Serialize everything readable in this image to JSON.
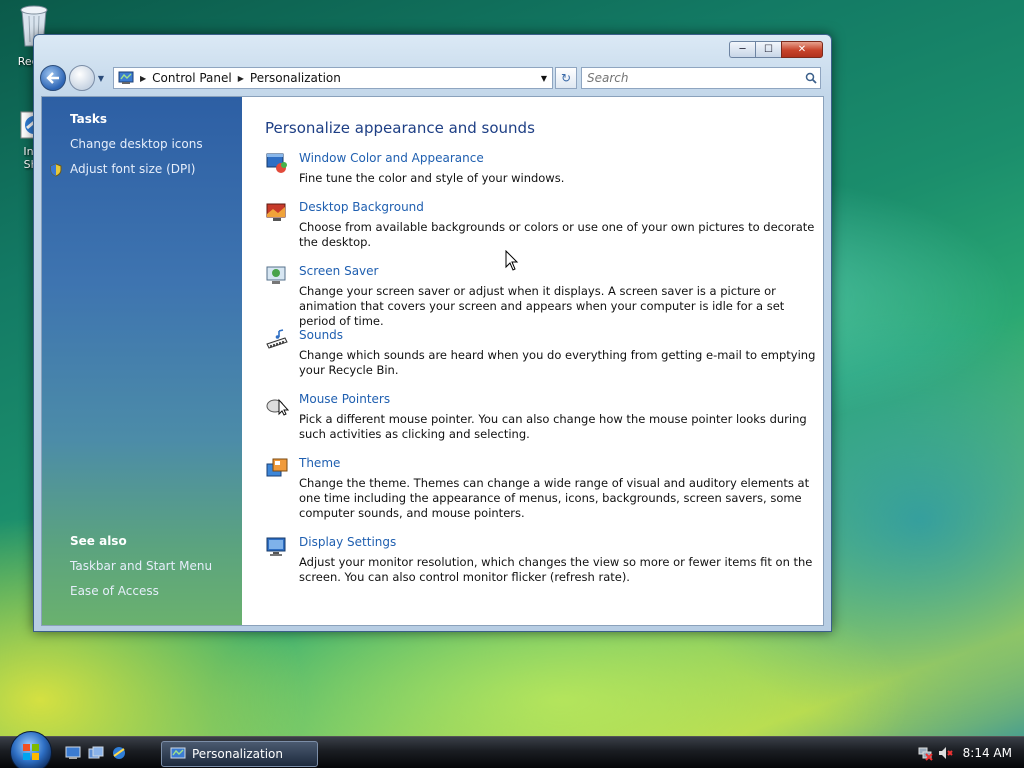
{
  "desktop": {
    "recycle_bin_label": "Recyc",
    "ie_label_line1": "Inte",
    "ie_label_line2": "Sho"
  },
  "window": {
    "caption_buttons": {
      "minimize": "─",
      "maximize": "☐",
      "close": "✕"
    },
    "address": {
      "crumbs": [
        "Control Panel",
        "Personalization"
      ],
      "separator": "▶",
      "dropdown": "▼"
    },
    "refresh_glyph": "↻",
    "search": {
      "placeholder": "Search"
    },
    "sidebar": {
      "tasks_heading": "Tasks",
      "tasks": [
        "Change desktop icons",
        "Adjust font size (DPI)"
      ],
      "see_also_heading": "See also",
      "see_also": [
        "Taskbar and Start Menu",
        "Ease of Access"
      ]
    },
    "main": {
      "title": "Personalize appearance and sounds",
      "items": [
        {
          "icon": "window-color-icon",
          "label": "Window Color and Appearance",
          "description": "Fine tune the color and style of your windows."
        },
        {
          "icon": "desktop-background-icon",
          "label": "Desktop Background",
          "description": "Choose from available backgrounds or colors or use one of your own pictures to decorate the desktop."
        },
        {
          "icon": "screen-saver-icon",
          "label": "Screen Saver",
          "description": "Change your screen saver or adjust when it displays. A screen saver is a picture or animation that covers your screen and appears when your computer is idle for a set period of time."
        },
        {
          "icon": "sounds-icon",
          "label": "Sounds",
          "description": "Change which sounds are heard when you do everything from getting e-mail to emptying your Recycle Bin."
        },
        {
          "icon": "mouse-pointers-icon",
          "label": "Mouse Pointers",
          "description": "Pick a different mouse pointer. You can also change how the mouse pointer looks during such activities as clicking and selecting."
        },
        {
          "icon": "theme-icon",
          "label": "Theme",
          "description": "Change the theme. Themes can change a wide range of visual and auditory elements at one time including the appearance of menus, icons, backgrounds, screen savers, some computer sounds, and mouse pointers."
        },
        {
          "icon": "display-settings-icon",
          "label": "Display Settings",
          "description": "Adjust your monitor resolution, which changes the view so more or fewer items fit on the screen. You can also control monitor flicker (refresh rate)."
        }
      ]
    }
  },
  "taskbar": {
    "active_task": "Personalization",
    "clock": "8:14 AM"
  }
}
